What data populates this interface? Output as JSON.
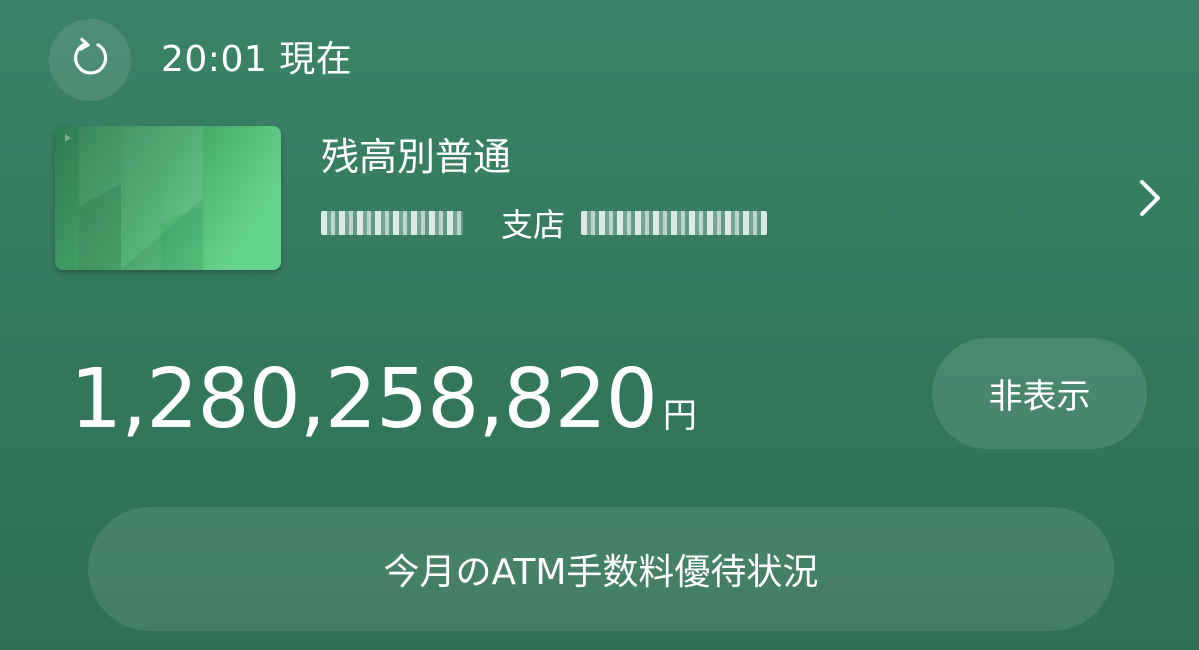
{
  "header": {
    "refresh_icon": "refresh-icon",
    "timestamp": "20:01 現在"
  },
  "account": {
    "card_icon": "bank-card-image",
    "name": "残高別普通",
    "branch_label": "支店",
    "chevron_icon": "chevron-right-icon"
  },
  "balance": {
    "amount": "1,280,258,820",
    "unit": "円",
    "hide_label": "非表示"
  },
  "atm": {
    "label": "今月のATM手数料優待状況"
  },
  "colors": {
    "background": "#347a5f",
    "text": "#ffffff",
    "card_accent": "#5ccb85"
  }
}
